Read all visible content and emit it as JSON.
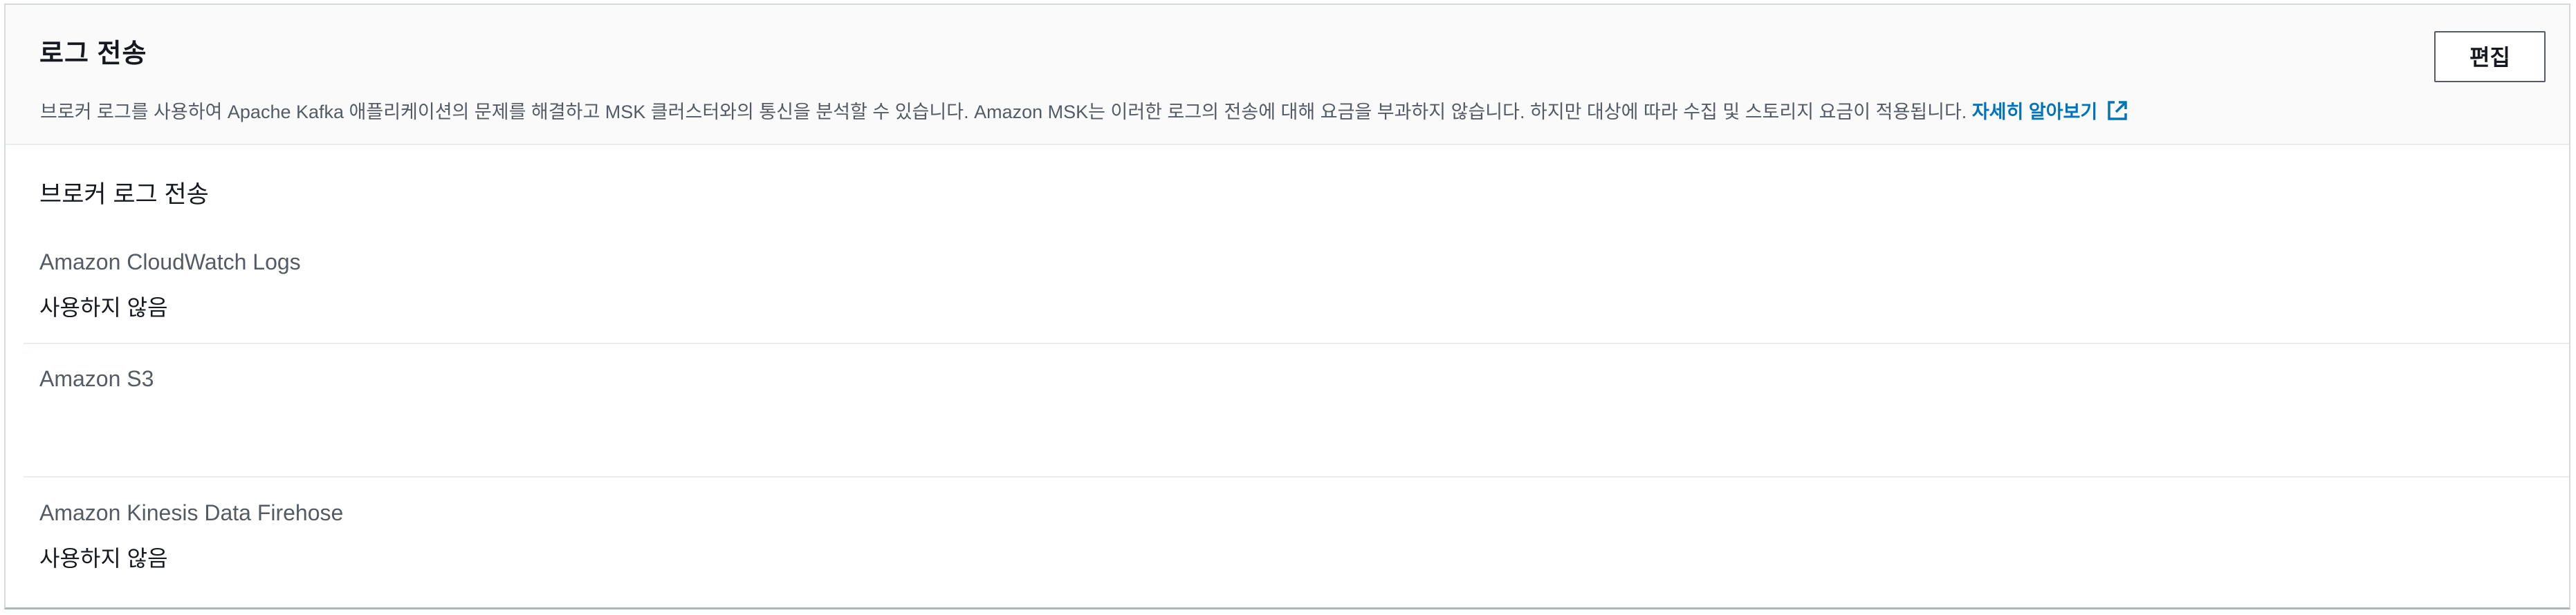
{
  "panel": {
    "title": "로그 전송",
    "description": "브로커 로그를 사용하여 Apache Kafka 애플리케이션의 문제를 해결하고 MSK 클러스터와의 통신을 분석할 수 있습니다. Amazon MSK는 이러한 로그의 전송에 대해 요금을 부과하지 않습니다. 하지만 대상에 따라 수집 및 스토리지 요금이 적용됩니다.",
    "learn_more_label": "자세히 알아보기",
    "learn_more_icon": "external-link-icon",
    "edit_label": "편집",
    "accent_color": "#0073bb"
  },
  "section": {
    "title": "브로커 로그 전송",
    "fields": [
      {
        "label": "Amazon CloudWatch Logs",
        "value": "사용하지 않음"
      },
      {
        "label": "Amazon S3",
        "value": ""
      },
      {
        "label": "Amazon Kinesis Data Firehose",
        "value": "사용하지 않음"
      }
    ]
  }
}
